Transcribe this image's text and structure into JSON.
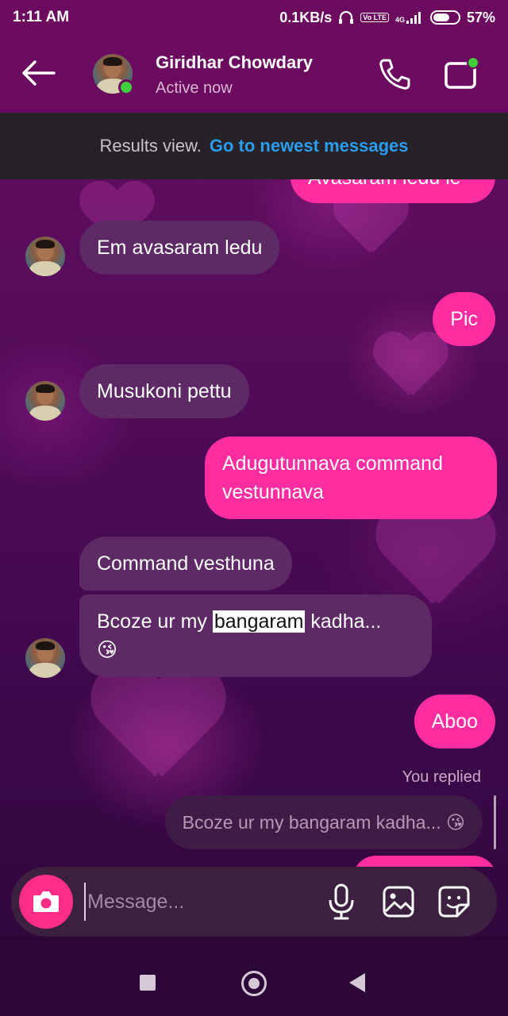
{
  "status_bar": {
    "time": "1:11 AM",
    "network_speed": "0.1KB/s",
    "volte_badge": "Vo LTE",
    "signal_badge": "4G",
    "battery": "57%"
  },
  "header": {
    "contact_name": "Giridhar Chowdary",
    "contact_status": "Active now",
    "icons": {
      "back": "arrow-left-icon",
      "call": "phone-icon",
      "video": "video-call-icon"
    }
  },
  "results_banner": {
    "text": "Results view.",
    "link": "Go to newest messages"
  },
  "messages": [
    {
      "dir": "out",
      "text": "Avasaram ledu le"
    },
    {
      "dir": "in",
      "text": "Em avasaram ledu"
    },
    {
      "dir": "out",
      "text": "Pic"
    },
    {
      "dir": "in",
      "text": "Musukoni pettu"
    },
    {
      "dir": "out",
      "text": "Adugutunnava command vestunnava"
    },
    {
      "dir": "in",
      "text": "Command vesthuna"
    },
    {
      "dir": "in",
      "text_before": "Bcoze ur my ",
      "highlight": "bangaram",
      "text_after": " kadha...",
      "emoji": "😘"
    },
    {
      "dir": "out",
      "text": "Aboo"
    }
  ],
  "reply": {
    "label": "You replied",
    "text": "Bcoze ur my bangaram kadha... 😘"
  },
  "composer": {
    "placeholder": "Message...",
    "icons": {
      "camera": "camera-icon",
      "mic": "microphone-icon",
      "image": "image-icon",
      "sticker": "sticker-icon"
    }
  },
  "colors": {
    "header_bg": "#6b0a5e",
    "incoming_bubble": "#5d2a66",
    "outgoing_bubble": "#ff2da0",
    "link": "#2a9df0",
    "online": "#3fcf3a"
  }
}
